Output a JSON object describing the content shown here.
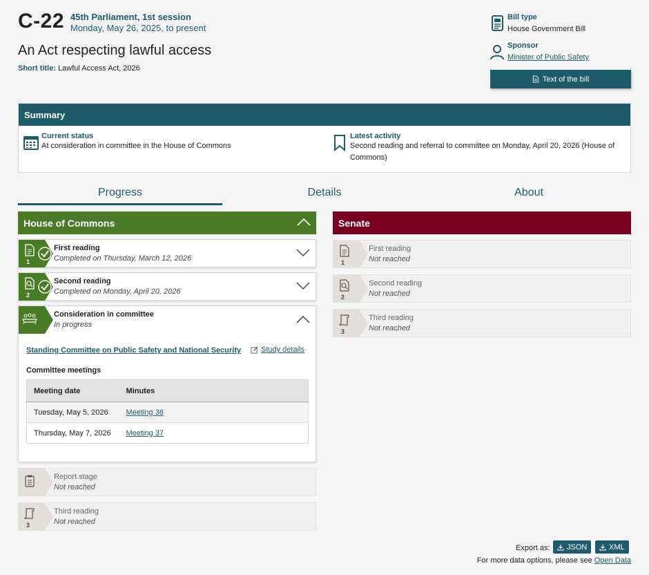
{
  "header": {
    "bill_number": "C-22",
    "session": "45th Parliament, 1st session",
    "dates": "Monday, May 26, 2025, to present",
    "title": "An Act respecting lawful access",
    "short_title_label": "Short title:",
    "short_title": "Lawful Access Act, 2026"
  },
  "meta": {
    "bill_type_label": "Bill type",
    "bill_type": "House Government Bill",
    "sponsor_label": "Sponsor",
    "sponsor": "Minister of Public Safety",
    "text_button": "Text of the bill"
  },
  "summary": {
    "heading": "Summary",
    "current_status_label": "Current status",
    "current_status": "At consideration in committee in the House of Commons",
    "latest_activity_label": "Latest activity",
    "latest_activity": "Second reading and referral to committee on Monday, April 20, 2026 (House of Commons)"
  },
  "tabs": [
    {
      "label": "Progress",
      "active": true
    },
    {
      "label": "Details",
      "active": false
    },
    {
      "label": "About",
      "active": false
    }
  ],
  "house": {
    "name": "House of Commons",
    "color": "#4a7c28",
    "stages": [
      {
        "name": "First reading",
        "status": "Completed on Thursday, March 12, 2026",
        "num": "1"
      },
      {
        "name": "Second reading",
        "status": "Completed on Monday, April 20, 2026",
        "num": "2"
      },
      {
        "name": "Consideration in committee",
        "status": "In progress",
        "num": ""
      },
      {
        "name": "Report stage",
        "status": "Not reached",
        "num": ""
      },
      {
        "name": "Third reading",
        "status": "Not reached",
        "num": "3"
      }
    ],
    "committee": {
      "name": "Standing Committee on Public Safety and National Security",
      "study_details": "Study details",
      "meetings_heading": "Committee meetings",
      "columns": [
        "Meeting date",
        "Minutes"
      ],
      "rows": [
        {
          "date": "Tuesday, May 5, 2026",
          "minutes": "Meeting 36"
        },
        {
          "date": "Thursday, May 7, 2026",
          "minutes": "Meeting 37"
        }
      ]
    }
  },
  "senate": {
    "name": "Senate",
    "color": "#7a0020",
    "stages": [
      {
        "name": "First reading",
        "status": "Not reached",
        "num": "1"
      },
      {
        "name": "Second reading",
        "status": "Not reached",
        "num": "2"
      },
      {
        "name": "Third reading",
        "status": "Not reached",
        "num": "3"
      }
    ]
  },
  "footer": {
    "export_label": "Export as:",
    "json_label": "JSON",
    "xml_label": "XML",
    "more_text": "For more data options, please see",
    "open_data": "Open Data"
  }
}
